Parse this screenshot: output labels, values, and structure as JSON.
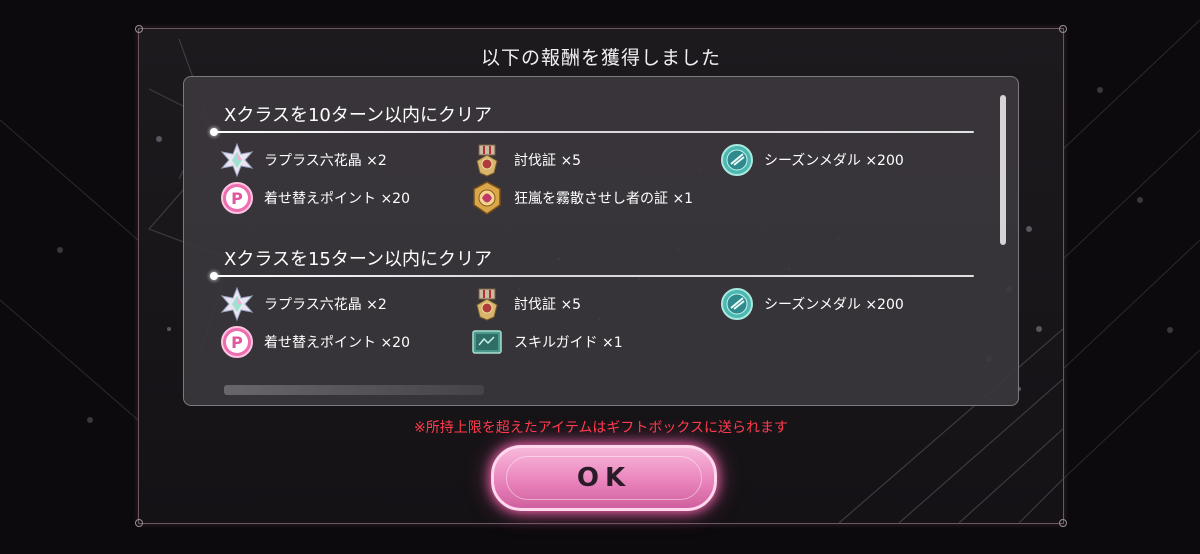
{
  "dialog": {
    "title": "以下の報酬を獲得しました",
    "notice": "※所持上限を超えたアイテムはギフトボックスに送られます",
    "ok_label": "OK"
  },
  "sections": [
    {
      "title": "Xクラスを10ターン以内にクリア",
      "rewards": [
        {
          "label": "ラプラス六花晶 ×2",
          "icon": "crystal-star-icon"
        },
        {
          "label": "討伐証 ×5",
          "icon": "medal-badge-icon"
        },
        {
          "label": "シーズンメダル ×200",
          "icon": "season-medal-icon"
        },
        {
          "label": "着せ替えポイント ×20",
          "icon": "pink-p-coin-icon"
        },
        {
          "label": "狂嵐を霧散させし者の証 ×1",
          "icon": "gold-emblem-icon"
        }
      ]
    },
    {
      "title": "Xクラスを15ターン以内にクリア",
      "rewards": [
        {
          "label": "ラプラス六花晶 ×2",
          "icon": "crystal-star-icon"
        },
        {
          "label": "討伐証 ×5",
          "icon": "medal-badge-icon"
        },
        {
          "label": "シーズンメダル ×200",
          "icon": "season-medal-icon"
        },
        {
          "label": "着せ替えポイント ×20",
          "icon": "pink-p-coin-icon"
        },
        {
          "label": "スキルガイド ×1",
          "icon": "skill-guide-scroll-icon"
        }
      ]
    }
  ],
  "colors": {
    "notice": "#ff3b4d",
    "button": "#ea84bd",
    "panel": "#3a373c"
  }
}
